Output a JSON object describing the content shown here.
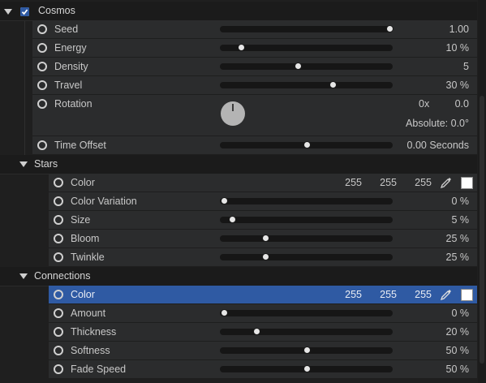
{
  "cosmos": {
    "label": "Cosmos",
    "enabled": true,
    "seed": {
      "label": "Seed",
      "value": "1.00",
      "slider": 0.98
    },
    "energy": {
      "label": "Energy",
      "value": "10 %",
      "slider": 0.12
    },
    "density": {
      "label": "Density",
      "value": "5",
      "slider": 0.45
    },
    "travel": {
      "label": "Travel",
      "value": "30 %",
      "slider": 0.65
    },
    "rotation": {
      "label": "Rotation",
      "turns": "0x",
      "degrees": "0.0",
      "absolute": "Absolute: 0.0°"
    },
    "time_offset": {
      "label": "Time Offset",
      "value": "0.00 Seconds",
      "slider": 0.5
    }
  },
  "stars": {
    "label": "Stars",
    "color": {
      "label": "Color",
      "r": "255",
      "g": "255",
      "b": "255",
      "swatch": "#ffffff"
    },
    "color_variation": {
      "label": "Color Variation",
      "value": "0 %",
      "slider": 0.02
    },
    "size": {
      "label": "Size",
      "value": "5 %",
      "slider": 0.07
    },
    "bloom": {
      "label": "Bloom",
      "value": "25 %",
      "slider": 0.26
    },
    "twinkle": {
      "label": "Twinkle",
      "value": "25 %",
      "slider": 0.26
    }
  },
  "connections": {
    "label": "Connections",
    "color": {
      "label": "Color",
      "r": "255",
      "g": "255",
      "b": "255",
      "swatch": "#ffffff"
    },
    "amount": {
      "label": "Amount",
      "value": "0 %",
      "slider": 0.02
    },
    "thickness": {
      "label": "Thickness",
      "value": "20 %",
      "slider": 0.21
    },
    "softness": {
      "label": "Softness",
      "value": "50 %",
      "slider": 0.5
    },
    "fade_speed": {
      "label": "Fade Speed",
      "value": "50 %",
      "slider": 0.5
    }
  },
  "colors": {
    "selected_row": "#2f5aa3",
    "checkbox_accent": "#2f5aa3"
  }
}
